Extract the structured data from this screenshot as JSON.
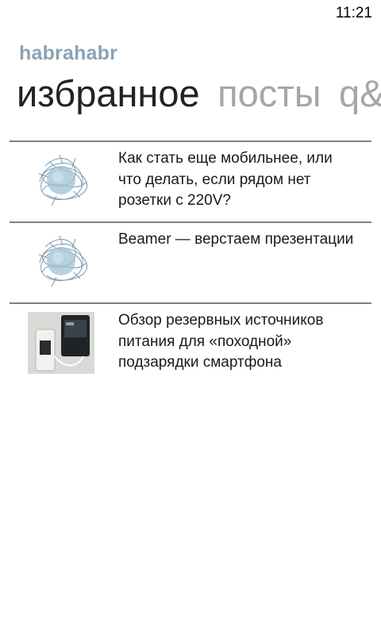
{
  "status_bar": {
    "time": "11:21"
  },
  "app": {
    "title": "habrahabr"
  },
  "pivot": {
    "items": [
      {
        "label": "избранное",
        "active": true
      },
      {
        "label": "посты",
        "active": false
      },
      {
        "label": "q&a",
        "active": false
      }
    ]
  },
  "posts": [
    {
      "title": "Как стать еще мобильнее, или что делать, если рядом нет розетки с 220V?",
      "thumb": "habr-logo"
    },
    {
      "title": "Beamer — верстаем презентации",
      "thumb": "habr-logo"
    },
    {
      "title": "Обзор резервных источников питания для «походной» подзарядки смартфона",
      "thumb": "device-photo"
    }
  ]
}
